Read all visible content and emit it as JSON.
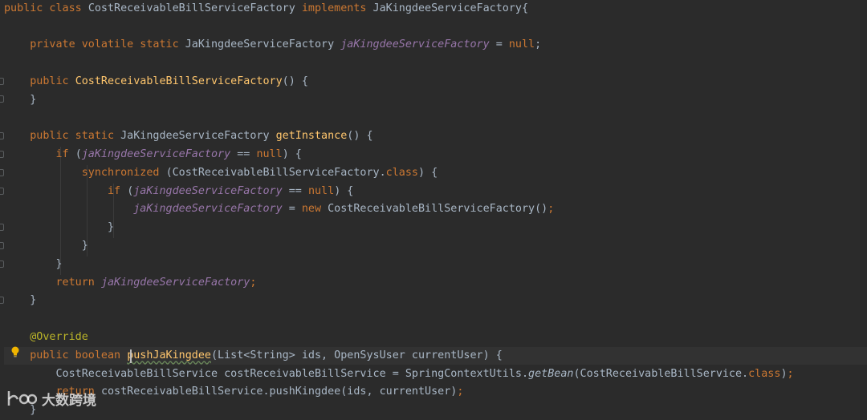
{
  "editor": {
    "lines": [
      {
        "id": "l1",
        "parts": [
          [
            "kw",
            "public class "
          ],
          [
            "ty",
            "CostReceivableBillServiceFactory "
          ],
          [
            "kw",
            "implements "
          ],
          [
            "ty",
            "JaKingdeeServiceFactory{"
          ]
        ]
      },
      {
        "id": "l2",
        "parts": []
      },
      {
        "id": "l3",
        "parts": [
          [
            "ty",
            "    "
          ],
          [
            "kw",
            "private volatile static "
          ],
          [
            "ty",
            "JaKingdeeServiceFactory "
          ],
          [
            "fld",
            "jaKingdeeServiceFactory"
          ],
          [
            "ty",
            " = "
          ],
          [
            "kw",
            "null"
          ],
          [
            "ty",
            ";"
          ]
        ]
      },
      {
        "id": "l4",
        "parts": []
      },
      {
        "id": "l5",
        "parts": [
          [
            "ty",
            "    "
          ],
          [
            "kw",
            "public "
          ],
          [
            "fn",
            "CostReceivableBillServiceFactory"
          ],
          [
            "ty",
            "() {"
          ]
        ]
      },
      {
        "id": "l6",
        "parts": [
          [
            "ty",
            "    }"
          ]
        ]
      },
      {
        "id": "l7",
        "parts": []
      },
      {
        "id": "l8",
        "parts": [
          [
            "ty",
            "    "
          ],
          [
            "kw",
            "public static "
          ],
          [
            "ty",
            "JaKingdeeServiceFactory "
          ],
          [
            "fn",
            "getInstance"
          ],
          [
            "ty",
            "() {"
          ]
        ]
      },
      {
        "id": "l9",
        "parts": [
          [
            "ty",
            "        "
          ],
          [
            "kw",
            "if "
          ],
          [
            "ty",
            "("
          ],
          [
            "fld",
            "jaKingdeeServiceFactory"
          ],
          [
            "ty",
            " == "
          ],
          [
            "kw",
            "null"
          ],
          [
            "ty",
            ") {"
          ]
        ]
      },
      {
        "id": "l10",
        "parts": [
          [
            "ty",
            "            "
          ],
          [
            "kw",
            "synchronized "
          ],
          [
            "ty",
            "(CostReceivableBillServiceFactory."
          ],
          [
            "kw",
            "class"
          ],
          [
            "ty",
            ") {"
          ]
        ]
      },
      {
        "id": "l11",
        "parts": [
          [
            "ty",
            "                "
          ],
          [
            "kw",
            "if "
          ],
          [
            "ty",
            "("
          ],
          [
            "fld",
            "jaKingdeeServiceFactory"
          ],
          [
            "ty",
            " == "
          ],
          [
            "kw",
            "null"
          ],
          [
            "ty",
            ") {"
          ]
        ]
      },
      {
        "id": "l12",
        "parts": [
          [
            "ty",
            "                    "
          ],
          [
            "fld",
            "jaKingdeeServiceFactory"
          ],
          [
            "ty",
            " = "
          ],
          [
            "kw",
            "new "
          ],
          [
            "ty",
            "CostReceivableBillServiceFactory()"
          ],
          [
            "kw",
            ";"
          ]
        ]
      },
      {
        "id": "l13",
        "parts": [
          [
            "ty",
            "                }"
          ]
        ]
      },
      {
        "id": "l14",
        "parts": [
          [
            "ty",
            "            }"
          ]
        ]
      },
      {
        "id": "l15",
        "parts": [
          [
            "ty",
            "        }"
          ]
        ]
      },
      {
        "id": "l16",
        "parts": [
          [
            "ty",
            "        "
          ],
          [
            "kw",
            "return "
          ],
          [
            "fld",
            "jaKingdeeServiceFactory"
          ],
          [
            "kw",
            ";"
          ]
        ]
      },
      {
        "id": "l17",
        "parts": [
          [
            "ty",
            "    }"
          ]
        ]
      },
      {
        "id": "l18",
        "parts": []
      },
      {
        "id": "l19",
        "parts": [
          [
            "ty",
            "    "
          ],
          [
            "anno",
            "@Override"
          ]
        ]
      },
      {
        "id": "l20",
        "parts": [
          [
            "ty",
            "    "
          ],
          [
            "kw",
            "public boolean "
          ],
          [
            "fn",
            "pushJaKingdee"
          ],
          [
            "ty",
            "(List<String> ids, OpenSysUser currentUser) {"
          ]
        ]
      },
      {
        "id": "l21",
        "parts": [
          [
            "ty",
            "        CostReceivableBillService costReceivableBillService = SpringContextUtils."
          ],
          [
            "st",
            "getBean"
          ],
          [
            "ty",
            "(CostReceivableBillService."
          ],
          [
            "kw",
            "class"
          ],
          [
            "ty",
            ")"
          ],
          [
            "kw",
            ";"
          ]
        ]
      },
      {
        "id": "l22",
        "parts": [
          [
            "ty",
            "        "
          ],
          [
            "kw",
            "return "
          ],
          [
            "ty",
            "costReceivableBillService.pushKingdee(ids, currentUser)"
          ],
          [
            "kw",
            ";"
          ]
        ]
      },
      {
        "id": "l23",
        "parts": [
          [
            "ty",
            "    }"
          ]
        ]
      }
    ],
    "current_line": "l20"
  },
  "watermark": {
    "text": "大数跨境"
  },
  "colors": {
    "background": "#2b2b2b",
    "keyword": "#cc7832",
    "method": "#ffc66d",
    "field": "#9876aa",
    "annotation": "#bbb529",
    "text": "#a9b7c6"
  }
}
